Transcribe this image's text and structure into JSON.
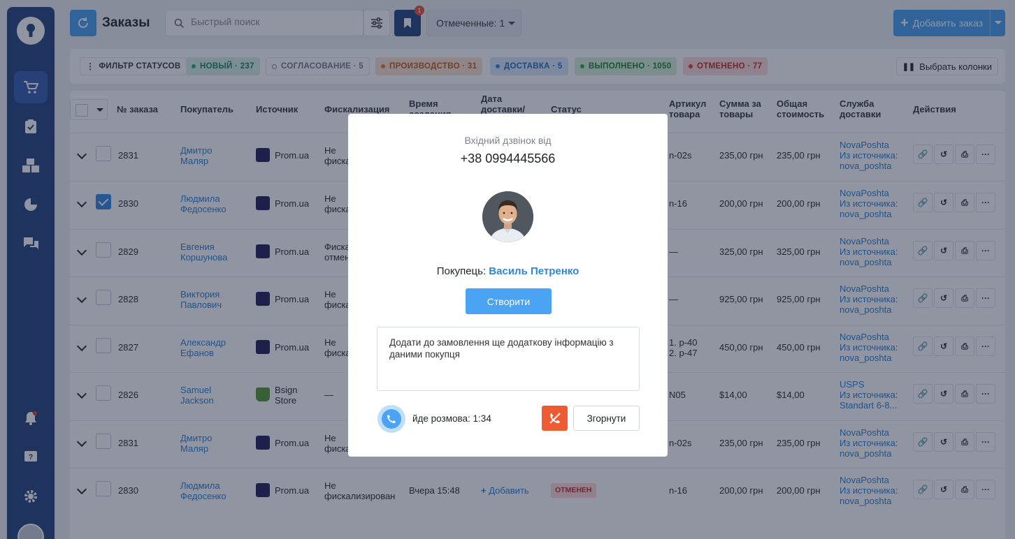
{
  "header": {
    "title": "Заказы",
    "search_placeholder": "Быстрый поиск",
    "bookmark_badge": "1",
    "marked_label": "Отмеченные: 1",
    "add_order_label": "Добавить заказ"
  },
  "status_filter": {
    "label": "ФИЛЬТР СТАТУСОВ",
    "choose_columns": "Выбрать колонки",
    "chips": [
      {
        "label": "НОВЫЙ · 237",
        "color": "#2fb37a"
      },
      {
        "label": "СОГЛАСОВАНИЕ · 5",
        "color": "#8a93a3"
      },
      {
        "label": "ПРОИЗВОДСТВО · 31",
        "color": "#e8803a"
      },
      {
        "label": "ДОСТАВКА · 5",
        "color": "#3a8de8"
      },
      {
        "label": "ВЫПОЛНЕНО · 1050",
        "color": "#2fb348"
      },
      {
        "label": "ОТМЕНЕНО · 77",
        "color": "#e8453a"
      }
    ]
  },
  "table": {
    "headers": [
      "№ заказа",
      "Покупатель",
      "Источник",
      "Фискализация",
      "Время создания",
      "Дата доставки/",
      "Статус",
      "Артикул товара",
      "Сумма за товары",
      "Общая стоимость",
      "Служба доставки",
      "Действия"
    ],
    "rows": [
      {
        "id": "2831",
        "buyer1": "Дмитро",
        "buyer2": "Маляр",
        "source1": "Prom.ua",
        "source2": "",
        "fisc1": "Не",
        "fisc2": "фиска",
        "time": "",
        "sku1": "n-02s",
        "sku2": "",
        "sum": "235,00 грн",
        "total": "235,00 грн",
        "d1": "NovaPoshta",
        "d2": "Из источника:",
        "d3": "nova_poshta",
        "checked": false,
        "src": "prom"
      },
      {
        "id": "2830",
        "buyer1": "Людмила",
        "buyer2": "Федосенко",
        "source1": "Prom.ua",
        "source2": "",
        "fisc1": "Не",
        "fisc2": "фиска",
        "time": "",
        "sku1": "n-16",
        "sku2": "",
        "sum": "200,00 грн",
        "total": "200,00 грн",
        "d1": "NovaPoshta",
        "d2": "Из источника:",
        "d3": "nova_poshta",
        "checked": true,
        "src": "prom"
      },
      {
        "id": "2829",
        "buyer1": "Евгения",
        "buyer2": "Коршунова",
        "source1": "Prom.ua",
        "source2": "",
        "fisc1": "Фиска",
        "fisc2": "отмен",
        "time": "",
        "sku1": "—",
        "sku2": "",
        "sum": "325,00 грн",
        "total": "325,00 грн",
        "d1": "NovaPoshta",
        "d2": "Из источника:",
        "d3": "nova_poshta",
        "checked": false,
        "src": "prom"
      },
      {
        "id": "2828",
        "buyer1": "Виктория",
        "buyer2": "Павлович",
        "source1": "Prom.ua",
        "source2": "",
        "fisc1": "Не",
        "fisc2": "фиска",
        "time": "",
        "sku1": "—",
        "sku2": "",
        "sum": "925,00 грн",
        "total": "925,00 грн",
        "d1": "NovaPoshta",
        "d2": "Из источника:",
        "d3": "nova_poshta",
        "checked": false,
        "src": "prom"
      },
      {
        "id": "2827",
        "buyer1": "Александр",
        "buyer2": "Ефанов",
        "source1": "Prom.ua",
        "source2": "",
        "fisc1": "Не",
        "fisc2": "фиска",
        "time": "",
        "sku1": "1. p-40",
        "sku2": "2. p-47",
        "sum": "450,00 грн",
        "total": "450,00 грн",
        "d1": "NovaPoshta",
        "d2": "Из источника:",
        "d3": "nova_poshta",
        "checked": false,
        "src": "prom"
      },
      {
        "id": "2826",
        "buyer1": "Samuel",
        "buyer2": "Jackson",
        "source1": "Bsign",
        "source2": "Store",
        "fisc1": "—",
        "fisc2": "",
        "time": "",
        "sku1": "N05",
        "sku2": "",
        "sum": "$14,00",
        "total": "$14,00",
        "d1": "USPS",
        "d2": "Из источника:",
        "d3": "Standart 6-8...",
        "checked": false,
        "src": "shop"
      },
      {
        "id": "2831",
        "buyer1": "Дмитро",
        "buyer2": "Маляр",
        "source1": "Prom.ua",
        "source2": "",
        "fisc1": "Не",
        "fisc2": "фиска",
        "time": "",
        "sku1": "n-02s",
        "sku2": "",
        "sum": "235,00 грн",
        "total": "235,00 грн",
        "d1": "NovaPoshta",
        "d2": "Из источника:",
        "d3": "nova_poshta",
        "checked": false,
        "src": "prom"
      },
      {
        "id": "2830",
        "buyer1": "Людмила",
        "buyer2": "Федосенко",
        "source1": "Prom.ua",
        "source2": "",
        "fisc1": "Не",
        "fisc2": "фискализирован",
        "time": "Вчера 15:48",
        "sku1": "n-16",
        "sku2": "",
        "sum": "200,00 грн",
        "total": "200,00 грн",
        "d1": "NovaPoshta",
        "d2": "Из источника:",
        "d3": "nova_poshta",
        "checked": false,
        "src": "prom",
        "add_label": "Добавить",
        "status_badge": "ОТМЕНЕН"
      }
    ]
  },
  "modal": {
    "subtitle": "Вхідний дзвінок від",
    "phone": "+38 0994445566",
    "buyer_label": "Покупець:",
    "buyer_name": "Василь Петренко",
    "create_label": "Створити",
    "note": "Додати до замовлення ще додаткову інформацію з даними покупця",
    "call_status": "йде розмова: 1:34",
    "collapse_label": "Згорнути"
  },
  "colors": {
    "sidebar": "#2d4a86",
    "accent": "#4aa3f3",
    "link": "#2f86d6",
    "hangup": "#ee5a32"
  }
}
